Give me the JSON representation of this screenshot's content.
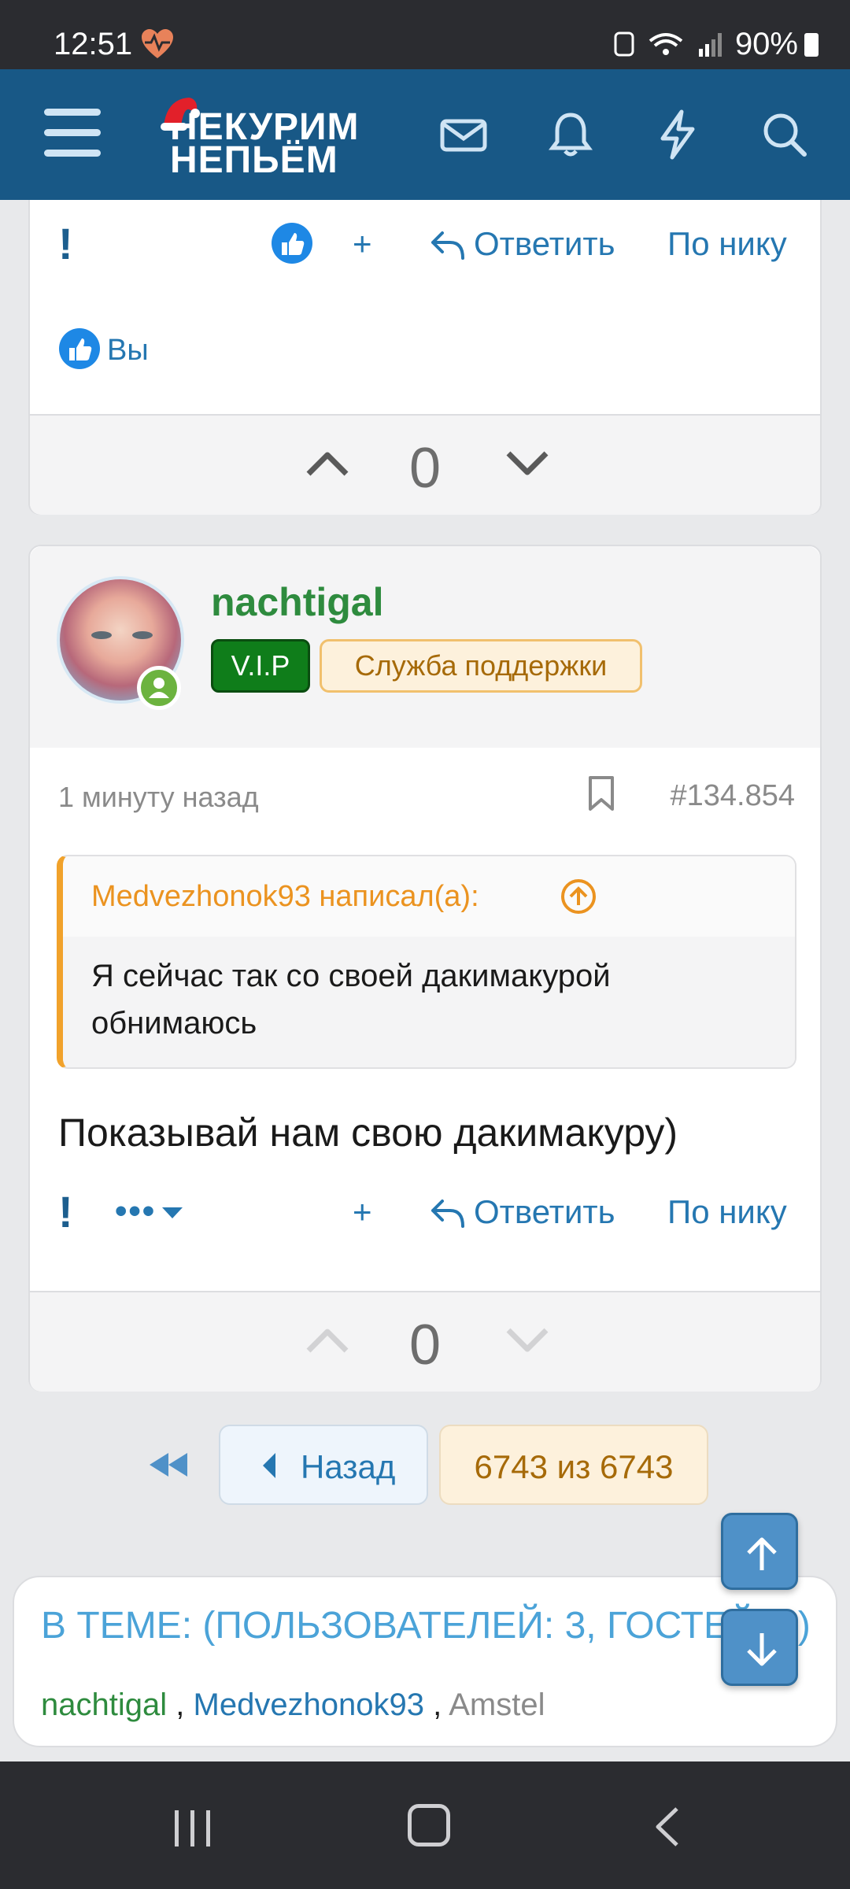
{
  "status_bar": {
    "time": "12:51",
    "battery": "90%"
  },
  "header": {
    "logo_line1": "НЕКУРИМ",
    "logo_line2": "НЕПЬЁМ",
    "icons": [
      "menu-icon",
      "mail-icon",
      "bell-icon",
      "lightning-icon",
      "search-icon"
    ]
  },
  "post1": {
    "actions": {
      "excl": "!",
      "plus": "+",
      "reply": "Ответить",
      "by_nick": "По нику"
    },
    "reacted_by": "Вы",
    "vote_score": "0"
  },
  "post2": {
    "username": "nachtigal",
    "badges": [
      "V.I.P",
      "Служба поддержки"
    ],
    "time": "1 минуту назад",
    "post_number": "#134.854",
    "quote": {
      "author": "Medvezhonok93 написал(а):",
      "text": "Я сейчас так со своей дакимакурой обнимаюсь"
    },
    "text": "Показывай нам свою дакимакуру)",
    "actions": {
      "excl": "!",
      "more": "•••",
      "plus": "+",
      "reply": "Ответить",
      "by_nick": "По нику"
    },
    "vote_score": "0"
  },
  "pagination": {
    "prev": "Назад",
    "current": "6743 из 6743"
  },
  "in_thread": {
    "title": "В ТЕМЕ: (ПОЛЬЗОВАТЕЛЕЙ: 3, ГОСТЕЙ: 0)",
    "users": [
      "nachtigal",
      "Medvezhonok93",
      "Amstel"
    ],
    "separator": ","
  },
  "colors": {
    "header_bg": "#185886",
    "link_blue": "#2577b1",
    "username_green": "#2e8b3e",
    "quote_accent": "#f1a22b",
    "vip_green": "#0f7d1a"
  }
}
